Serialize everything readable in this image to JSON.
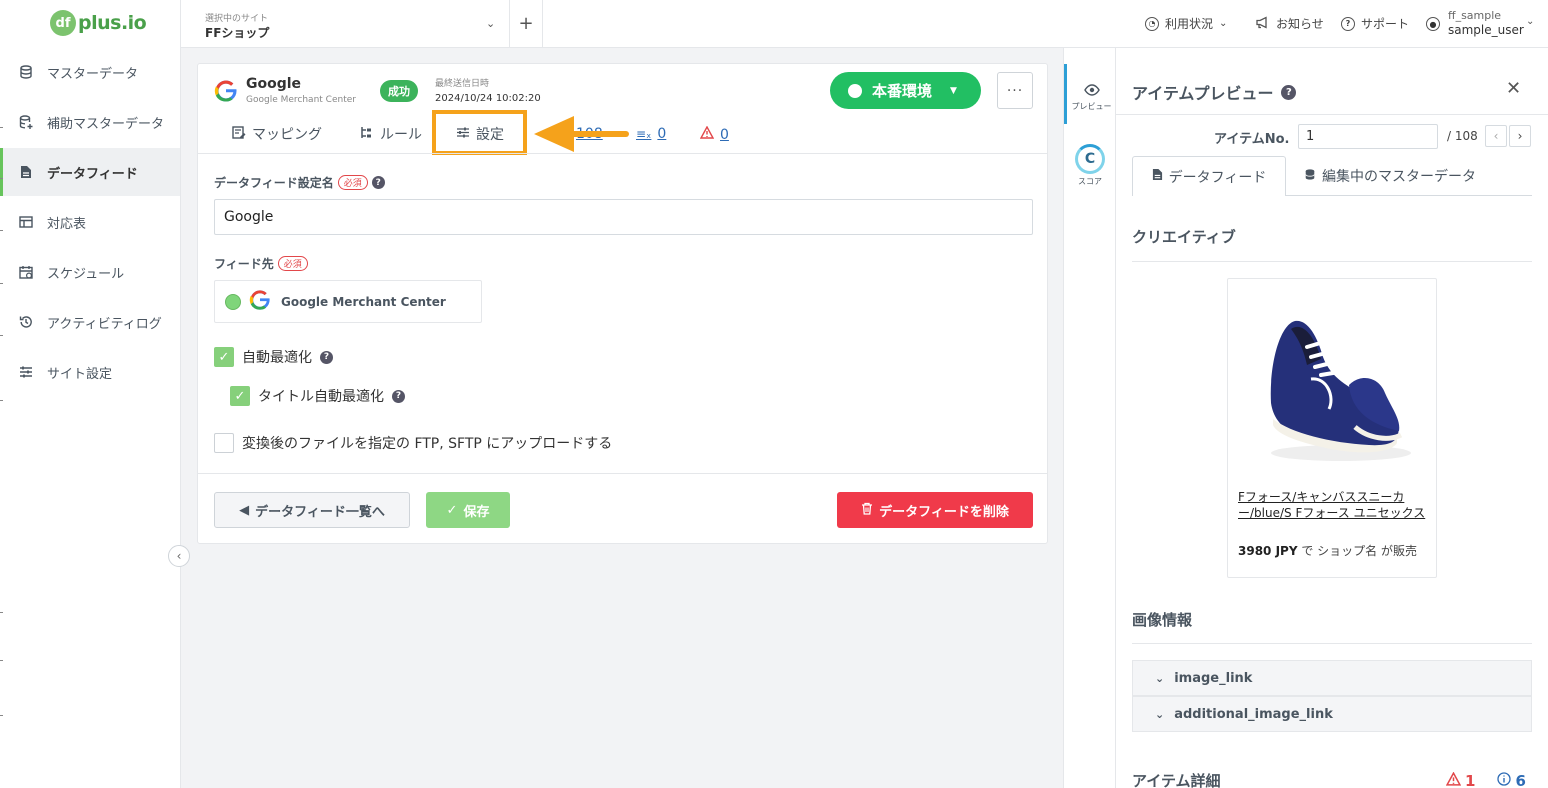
{
  "app": {
    "logo_text": "plus.io",
    "logo_mark": "df",
    "logo_tag": "— ── ──── ─────"
  },
  "sidebar": {
    "items": [
      {
        "label": "マスターデータ",
        "icon": "database-icon"
      },
      {
        "label": "補助マスターデータ",
        "icon": "database-plus-icon"
      },
      {
        "label": "データフィード",
        "icon": "file-icon",
        "active": true
      },
      {
        "label": "対応表",
        "icon": "table-icon"
      },
      {
        "label": "スケジュール",
        "icon": "calendar-icon"
      },
      {
        "label": "アクティビティログ",
        "icon": "history-icon"
      },
      {
        "label": "サイト設定",
        "icon": "sliders-icon"
      }
    ]
  },
  "topbar": {
    "site_label": "選択中のサイト",
    "site_value": "FFショップ",
    "usage": "利用状況",
    "news": "お知らせ",
    "support": "サポート",
    "user_org": "ff_sample",
    "user_name": "sample_user"
  },
  "feed": {
    "title": "Google",
    "subtitle": "Google Merchant Center",
    "status": "成功",
    "last_sent_label": "最終送信日時",
    "last_sent_value": "2024/10/24 10:02:20",
    "env_label": "本番環境",
    "more_label": "···"
  },
  "tabs": {
    "mapping": "マッピング",
    "rules": "ルール",
    "settings": "設定",
    "count_items": "108",
    "count_excluded": "0",
    "count_warnings": "0"
  },
  "form": {
    "name_label": "データフィード設定名",
    "required": "必須",
    "name_value": "Google",
    "dest_label": "フィード先",
    "dest_value": "Google Merchant Center",
    "auto_opt": "自動最適化",
    "title_auto_opt": "タイトル自動最適化",
    "ftp_upload": "変換後のファイルを指定の FTP, SFTP にアップロードする"
  },
  "actions": {
    "back": "データフィード一覧へ",
    "save": "保存",
    "delete": "データフィードを削除"
  },
  "rail": {
    "preview": "プレビュー",
    "score": "スコア",
    "score_letter": "C"
  },
  "preview": {
    "title": "アイテムプレビュー",
    "item_no_label": "アイテムNo.",
    "item_no_value": "1",
    "item_total": "/ 108",
    "tab_feed": "データフィード",
    "tab_master": "編集中のマスターデータ",
    "creative_title": "クリエイティブ",
    "product_name": "Fフォース/キャンバススニーカー/blue/S Fフォース ユニセックス",
    "product_price_amount": "3980 JPY",
    "product_price_rest": " で ショップ名 が販売",
    "image_info_title": "画像情報",
    "image_link": "image_link",
    "additional_image_link": "additional_image_link",
    "item_detail_title": "アイテム詳細",
    "warn_count": "1",
    "info_count": "6"
  },
  "colors": {
    "brand_green": "#22bf63",
    "success": "#3cb35b",
    "danger": "#f03a4a",
    "highlight": "#f5a21b",
    "link": "#2d6bb5"
  }
}
